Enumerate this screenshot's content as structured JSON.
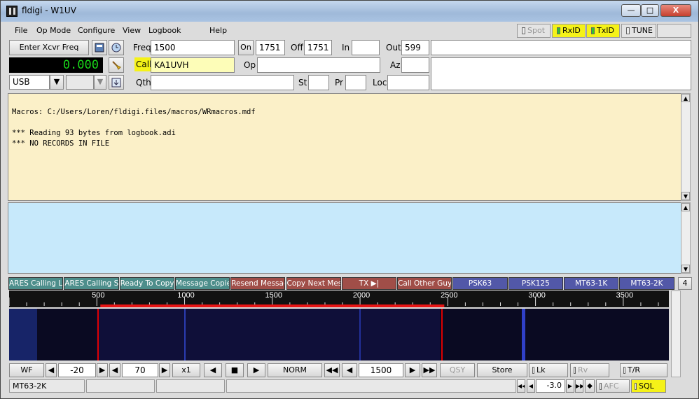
{
  "window": {
    "title": "fldigi - W1UV",
    "min": "—",
    "max": "□",
    "close": "X"
  },
  "menu": {
    "file": "File",
    "opmode": "Op Mode",
    "configure": "Configure",
    "view": "View",
    "logbook": "Logbook",
    "help": "Help"
  },
  "top_buttons": {
    "spot": "Spot",
    "rxid": "RxID",
    "txid": "TxID",
    "tune": "TUNE"
  },
  "rig": {
    "enter_xcvr": "Enter Xcvr Freq",
    "freq_display": "0.000",
    "mode": "USB"
  },
  "log": {
    "freq_label": "Freq",
    "freq_value": "1500",
    "on_label": "On",
    "on_value": "1751",
    "off_label": "Off",
    "off_value": "1751",
    "in_label": "In",
    "in_value": "",
    "out_label": "Out",
    "out_value": "599",
    "call_label": "Call",
    "call_value": "KA1UVH",
    "op_label": "Op",
    "op_value": "",
    "az_label": "Az",
    "az_value": "",
    "qth_label": "Qth",
    "qth_value": "",
    "st_label": "St",
    "st_value": "",
    "pr_label": "Pr",
    "pr_value": "",
    "loc_label": "Loc",
    "loc_value": ""
  },
  "rx_text": "Macros: C:/Users/Loren/fldigi.files/macros/WRmacros.mdf\n\n*** Reading 93 bytes from logbook.adi\n*** NO RECORDS IN FILE",
  "macros": [
    {
      "label": "ARES Calling Lon",
      "color": "#4d8e8b"
    },
    {
      "label": "ARES Calling Shor",
      "color": "#4d8e8b"
    },
    {
      "label": "Ready To Copy",
      "color": "#4d8e8b"
    },
    {
      "label": "Message Copied",
      "color": "#4d8e8b"
    },
    {
      "label": "Resend Message",
      "color": "#a04e48"
    },
    {
      "label": "Copy Next Messag",
      "color": "#a04e48"
    },
    {
      "label": "TX ▶|",
      "color": "#a04e48"
    },
    {
      "label": "Call Other Guy",
      "color": "#a04e48"
    },
    {
      "label": "PSK63",
      "color": "#5258a8"
    },
    {
      "label": "PSK125",
      "color": "#5258a8"
    },
    {
      "label": "MT63-1K",
      "color": "#5258a8"
    },
    {
      "label": "MT63-2K",
      "color": "#5258a8"
    }
  ],
  "macro_page": "4",
  "scale_labels": [
    "500",
    "1000",
    "1500",
    "2000",
    "2500",
    "3000",
    "3500"
  ],
  "controls": {
    "wf": "WF",
    "ref": "-20",
    "range": "70",
    "zoom": "x1",
    "norm": "NORM",
    "carrier": "1500",
    "qsy": "QSY",
    "store": "Store",
    "lk": "Lk",
    "rv": "Rv",
    "tr": "T/R"
  },
  "status": {
    "mode": "MT63-2K",
    "afc_value": "-3.0",
    "afc": "AFC",
    "sql": "SQL"
  }
}
